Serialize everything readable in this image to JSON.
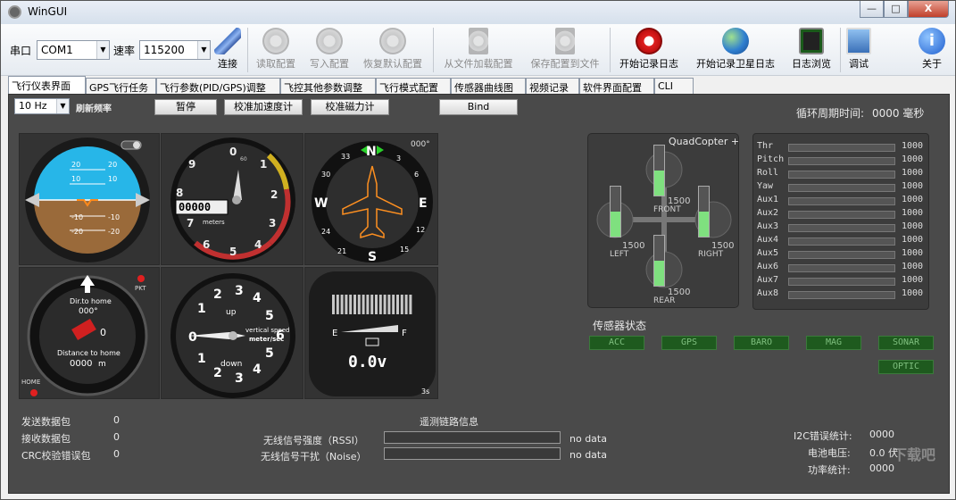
{
  "window": {
    "title": "WinGUI",
    "min": "—",
    "max": "□",
    "close": "X"
  },
  "toolbar": {
    "port_label": "串口",
    "port_value": "COM1",
    "baud_label": "速率",
    "baud_value": "115200",
    "connect": "连接",
    "read_config": "读取配置",
    "write_config": "写入配置",
    "restore_default": "恢复默认配置",
    "load_from_file": "从文件加载配置",
    "save_to_file": "保存配置到文件",
    "start_log": "开始记录日志",
    "start_sat_log": "开始记录卫星日志",
    "log_browse": "日志浏览",
    "debug": "调试",
    "about": "关于"
  },
  "tabs": [
    "飞行仪表界面",
    "GPS飞行任务",
    "飞行参数(PID/GPS)调整",
    "飞控其他参数调整",
    "飞行模式配置",
    "传感器曲线图",
    "视频记录",
    "软件界面配置",
    "CLI"
  ],
  "controls": {
    "rate_value": "10 Hz",
    "rate_label": "刷新频率",
    "pause": "暂停",
    "calib_acc": "校准加速度计",
    "calib_mag": "校准磁力计",
    "bind": "Bind",
    "cycle_label": "循环周期时间:",
    "cycle_value": "0000 毫秒"
  },
  "attitude": {
    "p20": "20",
    "p10": "10",
    "m10": "-10",
    "m20": "-20"
  },
  "altimeter": {
    "digits": "00000",
    "unit": "meters",
    "n0": "0",
    "n1": "1",
    "n2": "2",
    "n3": "3",
    "n4": "4",
    "n5": "5",
    "n6": "6",
    "n7": "7",
    "n8": "8",
    "n9": "9",
    "top": "60"
  },
  "heading": {
    "value": "000°",
    "n": "N",
    "e": "E",
    "s": "S",
    "w": "W",
    "t3": "3",
    "t6": "6",
    "t12": "12",
    "t15": "15",
    "t21": "21",
    "t24": "24",
    "t30": "30",
    "t33": "33"
  },
  "home": {
    "dir_label": "Dir.to home",
    "dir_value": "000°",
    "dist_label": "Distance to home",
    "dist_value": "0000",
    "dist_unit": "m",
    "sats": "0",
    "pkt": "PKT",
    "home": "HOME"
  },
  "vario": {
    "up": "up",
    "down": "down",
    "label1": "vertical speed",
    "label2": "meter/sec",
    "n0": "0",
    "n1": "1",
    "n2": "2",
    "n3": "3",
    "n4": "4",
    "n5": "5",
    "n6": "6"
  },
  "battery": {
    "e": "E",
    "f": "F",
    "voltage": "0.0v",
    "time": "3s"
  },
  "quad": {
    "title": "QuadCopter +",
    "front": "FRONT",
    "left": "LEFT",
    "right": "RIGHT",
    "rear": "REAR",
    "front_val": "1500",
    "left_val": "1500",
    "right_val": "1500",
    "rear_val": "1500",
    "motor_level": 0.5
  },
  "rc": [
    {
      "name": "Thr",
      "value": "1000"
    },
    {
      "name": "Pitch",
      "value": "1000"
    },
    {
      "name": "Roll",
      "value": "1000"
    },
    {
      "name": "Yaw",
      "value": "1000"
    },
    {
      "name": "Aux1",
      "value": "1000"
    },
    {
      "name": "Aux2",
      "value": "1000"
    },
    {
      "name": "Aux3",
      "value": "1000"
    },
    {
      "name": "Aux4",
      "value": "1000"
    },
    {
      "name": "Aux5",
      "value": "1000"
    },
    {
      "name": "Aux6",
      "value": "1000"
    },
    {
      "name": "Aux7",
      "value": "1000"
    },
    {
      "name": "Aux8",
      "value": "1000"
    }
  ],
  "sensors": {
    "title": "传感器状态",
    "acc": "ACC",
    "gps": "GPS",
    "baro": "BARO",
    "mag": "MAG",
    "sonar": "SONAR",
    "optic": "OPTIC"
  },
  "stats": {
    "sent_label": "发送数据包",
    "sent_value": "0",
    "recv_label": "接收数据包",
    "recv_value": "0",
    "crc_label": "CRC校验错误包",
    "crc_value": "0"
  },
  "link": {
    "title": "遥测链路信息",
    "rssi_label": "无线信号强度（RSSI）",
    "rssi_value": "no data",
    "noise_label": "无线信号干扰（Noise）",
    "noise_value": "no data"
  },
  "right_stats": {
    "i2c_label": "I2C错误统计:",
    "i2c_value": "0000",
    "volt_label": "电池电压:",
    "volt_value": "0.0 伏",
    "power_label": "功率统计:",
    "power_value": "0000"
  },
  "watermark": "下载吧"
}
